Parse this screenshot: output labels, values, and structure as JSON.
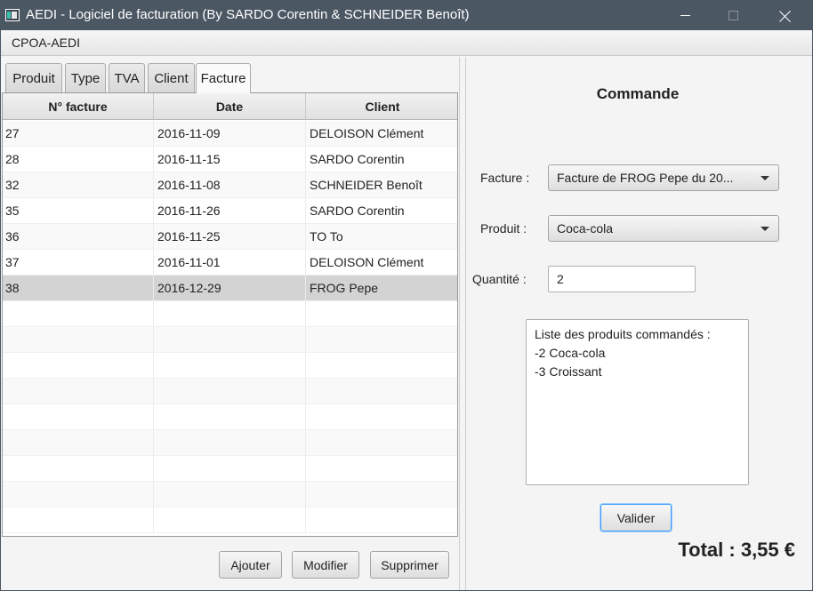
{
  "window": {
    "title": "AEDI - Logiciel de facturation (By SARDO Corentin & SCHNEIDER Benoît)"
  },
  "menu": {
    "items": [
      "CPOA-AEDI"
    ]
  },
  "tabs": [
    {
      "label": "Produit"
    },
    {
      "label": "Type"
    },
    {
      "label": "TVA"
    },
    {
      "label": "Client"
    },
    {
      "label": "Facture",
      "selected": true
    }
  ],
  "table": {
    "columns": [
      "N° facture",
      "Date",
      "Client"
    ],
    "rows": [
      {
        "num": "27",
        "date": "2016-11-09",
        "client": "DELOISON Clément"
      },
      {
        "num": "28",
        "date": "2016-11-15",
        "client": "SARDO Corentin"
      },
      {
        "num": "32",
        "date": "2016-11-08",
        "client": "SCHNEIDER Benoît"
      },
      {
        "num": "35",
        "date": "2016-11-26",
        "client": "SARDO Corentin"
      },
      {
        "num": "36",
        "date": "2016-11-25",
        "client": "TO To"
      },
      {
        "num": "37",
        "date": "2016-11-01",
        "client": "DELOISON Clément"
      },
      {
        "num": "38",
        "date": "2016-12-29",
        "client": "FROG Pepe",
        "selected": true
      }
    ]
  },
  "actions": {
    "add_label": "Ajouter",
    "edit_label": "Modifier",
    "delete_label": "Supprimer"
  },
  "commande": {
    "title": "Commande",
    "facture_label": "Facture :",
    "facture_value": "Facture de FROG Pepe du 20...",
    "produit_label": "Produit :",
    "produit_value": "Coca-cola",
    "quantite_label": "Quantité :",
    "quantite_value": "2",
    "list_lines": [
      "Liste des produits commandés :",
      "-2 Coca-cola",
      "-3 Croissant"
    ],
    "validate_label": "Valider",
    "total": "Total : 3,55 €"
  }
}
